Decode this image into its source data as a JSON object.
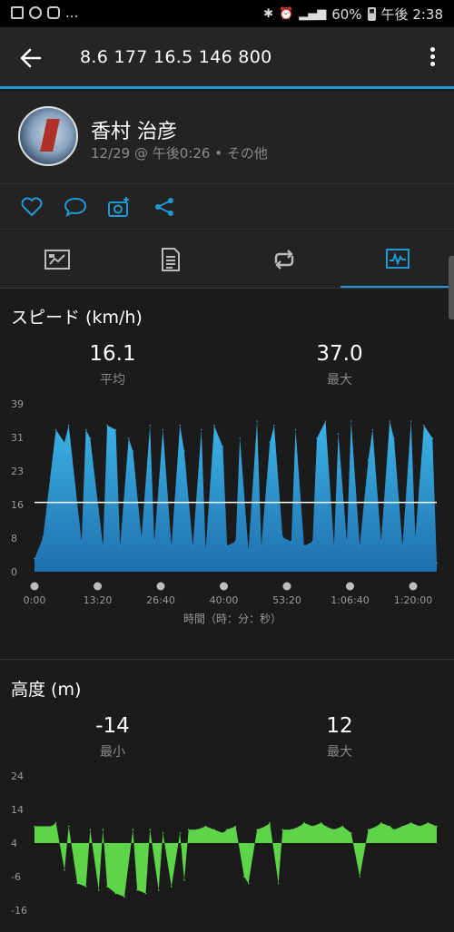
{
  "status_bar": {
    "left_icons": [
      "gallery-icon",
      "sync-icon",
      "instagram-icon"
    ],
    "ellipsis": "...",
    "battery": "60%",
    "time": "午後 2:38"
  },
  "app_bar": {
    "title": "8.6  177  16.5  146  800"
  },
  "activity": {
    "user_name": "香村 治彦",
    "meta": "12/29 @ 午後0:26 • その他"
  },
  "actions": [
    "heart-icon",
    "comment-icon",
    "add-photo-icon",
    "share-icon"
  ],
  "tabs": [
    {
      "icon": "map-icon",
      "active": false
    },
    {
      "icon": "stats-list-icon",
      "active": false
    },
    {
      "icon": "laps-icon",
      "active": false
    },
    {
      "icon": "chart-icon",
      "active": true
    }
  ],
  "speed": {
    "title": "スピード (km/h)",
    "avg_value": "16.1",
    "avg_label": "平均",
    "max_value": "37.0",
    "max_label": "最大"
  },
  "elevation": {
    "title": "高度 (m)",
    "min_value": "-14",
    "min_label": "最小",
    "max_value": "12",
    "max_label": "最大"
  },
  "chart_data": [
    {
      "type": "area",
      "title": "スピード (km/h)",
      "xlabel": "時間（時：分：秒）",
      "ylabel": "",
      "x_tick_labels": [
        "0:00",
        "13:20",
        "26:40",
        "40:00",
        "53:20",
        "1:06:40",
        "1:20:00"
      ],
      "y_tick_labels": [
        "0",
        "8",
        "16",
        "23",
        "31",
        "39"
      ],
      "ylim": [
        0,
        39
      ],
      "xlim_seconds": [
        0,
        5640
      ],
      "average_line": 16.1,
      "color": "#2d9fd6",
      "x_seconds": [
        0,
        120,
        300,
        420,
        480,
        660,
        720,
        780,
        960,
        1020,
        1140,
        1200,
        1320,
        1380,
        1500,
        1620,
        1680,
        1800,
        1920,
        2040,
        2100,
        2220,
        2340,
        2400,
        2520,
        2640,
        2700,
        2820,
        2880,
        3000,
        3120,
        3180,
        3300,
        3360,
        3480,
        3600,
        3660,
        3780,
        3900,
        3960,
        4080,
        4200,
        4260,
        4380,
        4440,
        4560,
        4680,
        4740,
        4860,
        4980,
        5040,
        5160,
        5280,
        5340,
        5460,
        5580,
        5640
      ],
      "values": [
        3,
        8,
        33,
        30,
        34,
        7,
        33,
        31,
        6,
        34,
        33,
        6,
        31,
        28,
        8,
        34,
        7,
        33,
        6,
        34,
        28,
        6,
        33,
        5,
        34,
        29,
        6,
        7,
        31,
        5,
        35,
        6,
        30,
        34,
        8,
        7,
        33,
        6,
        7,
        31,
        35,
        6,
        32,
        7,
        35,
        6,
        26,
        33,
        7,
        35,
        31,
        6,
        35,
        8,
        34,
        31,
        2
      ],
      "grid": false
    },
    {
      "type": "area",
      "title": "高度 (m)",
      "xlabel": "",
      "ylabel": "",
      "y_tick_labels": [
        "-16",
        "-6",
        "4",
        "14",
        "24"
      ],
      "ylim": [
        -16,
        24
      ],
      "xlim_seconds": [
        0,
        5640
      ],
      "color": "#5ed448",
      "x_seconds": [
        0,
        240,
        300,
        420,
        480,
        600,
        720,
        780,
        900,
        960,
        1020,
        1140,
        1260,
        1380,
        1440,
        1560,
        1620,
        1740,
        1800,
        1920,
        2040,
        2100,
        2160,
        2280,
        2400,
        2520,
        2640,
        2700,
        2820,
        2940,
        3000,
        3120,
        3240,
        3300,
        3420,
        3480,
        3600,
        3720,
        3780,
        3900,
        4020,
        4080,
        4200,
        4320,
        4440,
        4560,
        4680,
        4800,
        4860,
        4980,
        5040,
        5160,
        5280,
        5400,
        5520,
        5640
      ],
      "values": [
        9,
        9,
        10,
        -4,
        9,
        -8,
        -9,
        8,
        -10,
        8,
        -9,
        -11,
        -12,
        8,
        -10,
        -11,
        8,
        -10,
        7,
        -9,
        7,
        -7,
        8,
        8,
        9,
        8,
        7,
        8,
        9,
        -6,
        -8,
        8,
        9,
        10,
        -8,
        8,
        8,
        9,
        10,
        9,
        10,
        9,
        8,
        9,
        7,
        -6,
        8,
        9,
        10,
        9,
        8,
        9,
        10,
        9,
        10,
        9
      ],
      "grid": false
    }
  ]
}
